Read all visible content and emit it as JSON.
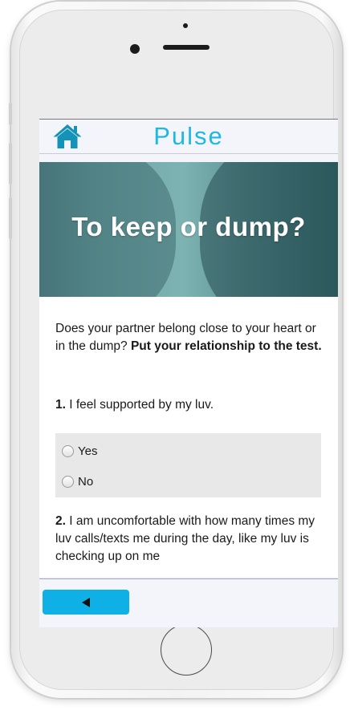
{
  "app": {
    "title": "Pulse",
    "accent_color": "#1fb8e0",
    "home_icon": "home-icon"
  },
  "hero": {
    "title": "To keep or dump?"
  },
  "intro": {
    "text": "Does your partner belong close to your heart or in the dump?",
    "emphasis": "Put your relationship to the test."
  },
  "questions": [
    {
      "number": "1.",
      "text": "I feel supported by my luv.",
      "options": [
        {
          "label": "Yes",
          "selected": false
        },
        {
          "label": "No",
          "selected": false
        }
      ]
    },
    {
      "number": "2.",
      "text": "I am uncomfortable with how many times my luv calls/texts me during the day, like my luv is checking up on me"
    }
  ],
  "footer": {
    "back_icon": "back-arrow-icon",
    "back_color": "#0fb0e6"
  }
}
